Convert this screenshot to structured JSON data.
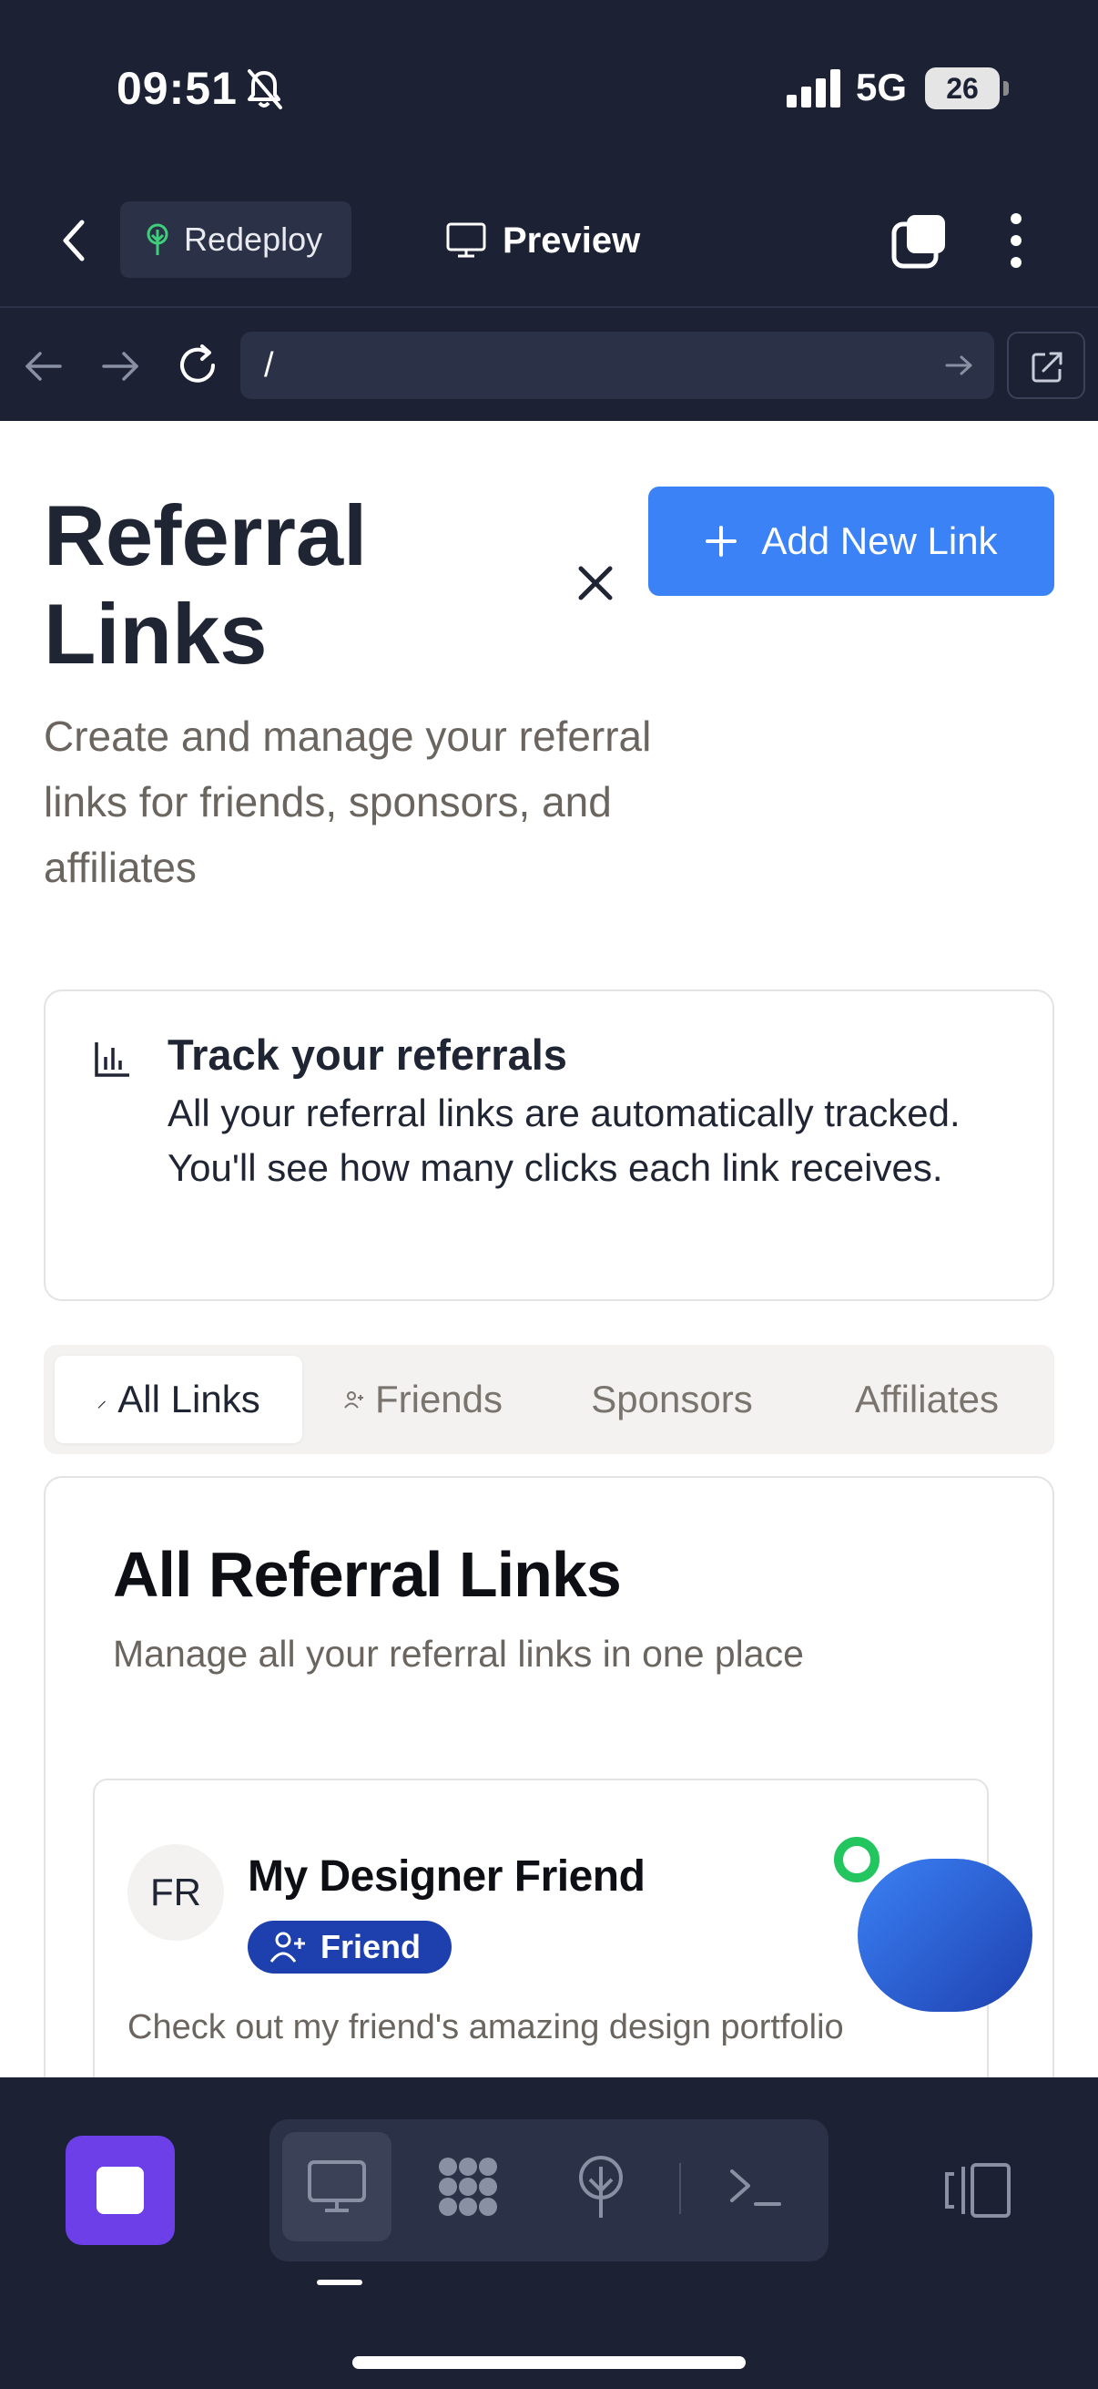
{
  "status_bar": {
    "time": "09:51",
    "network": "5G",
    "battery": "26"
  },
  "toolbar": {
    "redeploy_label": "Redeploy",
    "preview_label": "Preview"
  },
  "address_bar": {
    "url": "/"
  },
  "page": {
    "title": "Referral Links",
    "subtitle": "Create and manage your referral links for friends, sponsors, and affiliates",
    "add_button_label": "Add New Link",
    "add_button_color": "#3b82f6"
  },
  "info_card": {
    "title": "Track your referrals",
    "body": "All your referral links are automatically tracked. You'll see how many clicks each link receives."
  },
  "tabs": [
    {
      "label": "All Links",
      "active": true
    },
    {
      "label": "Friends",
      "active": false
    },
    {
      "label": "Sponsors",
      "active": false
    },
    {
      "label": "Affiliates",
      "active": false
    }
  ],
  "list": {
    "title": "All Referral Links",
    "subtitle": "Manage all your referral links in one place",
    "items": [
      {
        "initials": "FR",
        "name": "My Designer Friend",
        "type": "Friend",
        "type_color": "#1e40af",
        "description": "Check out my friend's amazing design portfolio"
      }
    ]
  },
  "colors": {
    "chrome_bg": "#1c2133",
    "chrome_surface": "#2b3146",
    "dock_app": "#6d3fe8",
    "status_online": "#22c55e"
  },
  "icons": {
    "back": "chevron-left-icon",
    "redeploy": "tree-icon",
    "preview": "monitor-icon",
    "tabs": "tabs-icon",
    "more": "more-vertical-icon",
    "reload": "reload-icon",
    "external": "external-link-icon",
    "close": "close-icon",
    "add": "plus-icon",
    "info": "bar-chart-icon",
    "friend": "user-plus-icon",
    "dock": [
      "monitor-icon",
      "grid-icon",
      "tree-icon",
      "terminal-icon",
      "panel-icon"
    ]
  }
}
